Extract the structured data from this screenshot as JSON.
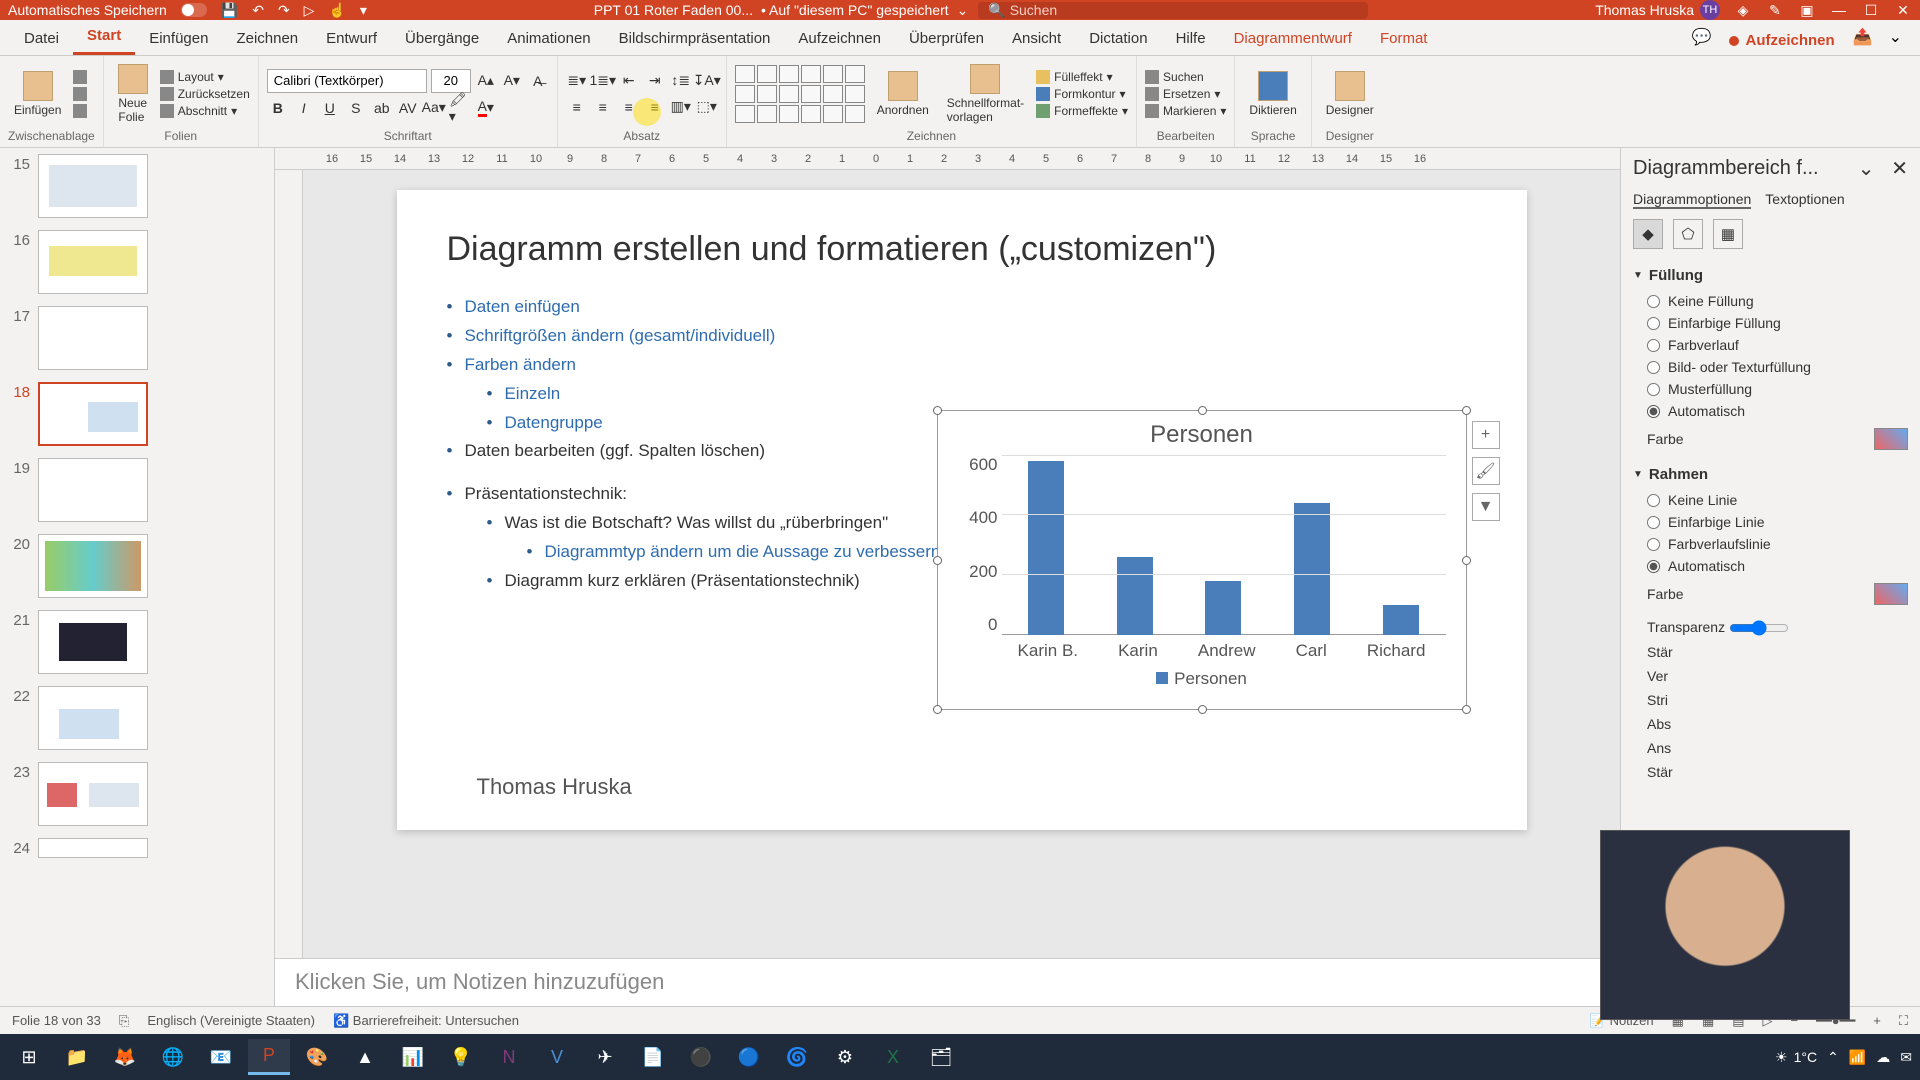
{
  "titlebar": {
    "autosave_label": "Automatisches Speichern",
    "doc_name": "PPT 01 Roter Faden 00...",
    "saved_status": "• Auf \"diesem PC\" gespeichert",
    "search_placeholder": "Suchen",
    "user_name": "Thomas Hruska",
    "user_initials": "TH"
  },
  "tabs": {
    "items": [
      "Datei",
      "Start",
      "Einfügen",
      "Zeichnen",
      "Entwurf",
      "Übergänge",
      "Animationen",
      "Bildschirmpräsentation",
      "Aufzeichnen",
      "Überprüfen",
      "Ansicht",
      "Dictation",
      "Hilfe",
      "Diagrammentwurf",
      "Format"
    ],
    "active": 1,
    "contextual": [
      13,
      14
    ],
    "record_btn": "Aufzeichnen"
  },
  "ribbon": {
    "clipboard": {
      "paste": "Einfügen",
      "group": "Zwischenablage"
    },
    "slides": {
      "new": "Neue\nFolie",
      "layout": "Layout",
      "reset": "Zurücksetzen",
      "section": "Abschnitt",
      "group": "Folien"
    },
    "font": {
      "name": "Calibri (Textkörper)",
      "size": "20",
      "group": "Schriftart"
    },
    "paragraph": {
      "group": "Absatz"
    },
    "drawing": {
      "arrange": "Anordnen",
      "quick": "Schnellformat-\nvorlagen",
      "fill": "Fülleffekt",
      "outline": "Formkontur",
      "effects": "Formeffekte",
      "group": "Zeichnen"
    },
    "editing": {
      "find": "Suchen",
      "replace": "Ersetzen",
      "select": "Markieren",
      "group": "Bearbeiten"
    },
    "voice": {
      "dictate": "Diktieren",
      "group": "Sprache"
    },
    "designer": {
      "btn": "Designer",
      "group": "Designer"
    }
  },
  "ruler_h": [
    "16",
    "15",
    "14",
    "13",
    "12",
    "11",
    "10",
    "9",
    "8",
    "7",
    "6",
    "5",
    "4",
    "3",
    "2",
    "1",
    "0",
    "1",
    "2",
    "3",
    "4",
    "5",
    "6",
    "7",
    "8",
    "9",
    "10",
    "11",
    "12",
    "13",
    "14",
    "15",
    "16"
  ],
  "thumbs": {
    "items": [
      {
        "n": "15"
      },
      {
        "n": "16"
      },
      {
        "n": "17"
      },
      {
        "n": "18",
        "sel": true
      },
      {
        "n": "19"
      },
      {
        "n": "20"
      },
      {
        "n": "21"
      },
      {
        "n": "22"
      },
      {
        "n": "23"
      },
      {
        "n": "24"
      }
    ]
  },
  "slide": {
    "title": "Diagramm erstellen und formatieren („customizen\")",
    "b1": "Daten einfügen",
    "b2": "Schriftgrößen ändern (gesamt/individuell)",
    "b3": "Farben ändern",
    "b3a": "Einzeln",
    "b3b": "Datengruppe",
    "b4": "Daten bearbeiten (ggf. Spalten löschen)",
    "b5": "Präsentationstechnik:",
    "b5a": "Was ist die Botschaft? Was willst du „rüberbringen\"",
    "b5a1": "Diagrammtyp ändern um die Aussage zu verbessern",
    "b5b": "Diagramm kurz erklären (Präsentationstechnik)",
    "author": "Thomas Hruska"
  },
  "chart_data": {
    "type": "bar",
    "title": "Personen",
    "categories": [
      "Karin B.",
      "Karin",
      "Andrew",
      "Carl",
      "Richard"
    ],
    "values": [
      580,
      260,
      180,
      440,
      100
    ],
    "ylim": [
      0,
      600
    ],
    "yticks": [
      "600",
      "400",
      "200",
      "0"
    ],
    "legend": "Personen"
  },
  "notes": {
    "placeholder": "Klicken Sie, um Notizen hinzuzufügen"
  },
  "pane": {
    "title": "Diagrammbereich f...",
    "tab1": "Diagrammoptionen",
    "tab2": "Textoptionen",
    "fill_hdr": "Füllung",
    "fill_opts": [
      "Keine Füllung",
      "Einfarbige Füllung",
      "Farbverlauf",
      "Bild- oder Texturfüllung",
      "Musterfüllung",
      "Automatisch"
    ],
    "fill_selected": 5,
    "color_lbl": "Farbe",
    "border_hdr": "Rahmen",
    "border_opts": [
      "Keine Linie",
      "Einfarbige Linie",
      "Farbverlaufslinie",
      "Automatisch"
    ],
    "border_selected": 3,
    "transp": "Transparenz",
    "trunc": [
      "Stär",
      "Ver",
      "Stri",
      "Abs",
      "Ans",
      "Stär"
    ]
  },
  "status": {
    "slide": "Folie 18 von 33",
    "lang": "Englisch (Vereinigte Staaten)",
    "access": "Barrierefreiheit: Untersuchen",
    "notes": "Notizen"
  },
  "taskbar": {
    "weather": "1°C"
  }
}
